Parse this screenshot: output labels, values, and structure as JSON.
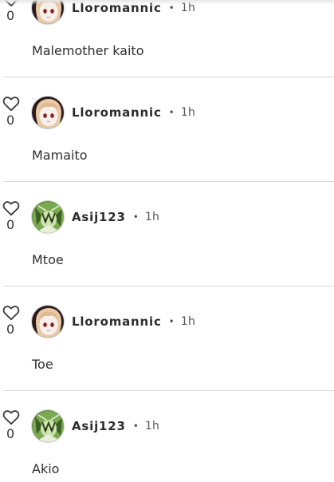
{
  "comments": [
    {
      "username": "Lloromannic",
      "separator": "•",
      "time": "1h",
      "likes": "0",
      "text": "Malemother kaito",
      "avatar": "pale-doll-avatar"
    },
    {
      "username": "Lloromannic",
      "separator": "•",
      "time": "1h",
      "likes": "0",
      "text": "Mamaito",
      "avatar": "pale-doll-avatar"
    },
    {
      "username": "Asij123",
      "separator": "•",
      "time": "1h",
      "likes": "0",
      "text": "Mtoe",
      "avatar": "green-character-avatar"
    },
    {
      "username": "Lloromannic",
      "separator": "•",
      "time": "1h",
      "likes": "0",
      "text": "Toe",
      "avatar": "pale-doll-avatar"
    },
    {
      "username": "Asij123",
      "separator": "•",
      "time": "1h",
      "likes": "0",
      "text": "Akio",
      "avatar": "green-character-avatar"
    }
  ],
  "icons": {
    "like": "heart-outline-icon"
  },
  "colors": {
    "divider": "#d9d9d9",
    "text": "#2d2d2d",
    "muted": "#555555"
  }
}
